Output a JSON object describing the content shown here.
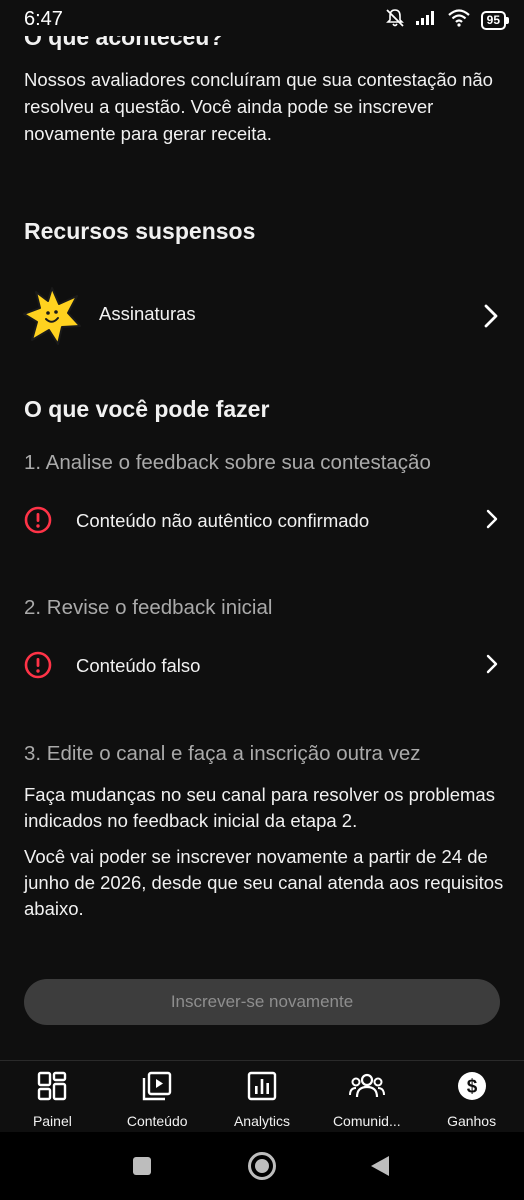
{
  "status_bar": {
    "time": "6:47",
    "battery": "95"
  },
  "intro": {
    "heading": "O que aconteceu?",
    "body": "Nossos avaliadores concluíram que sua contestação não resolveu a questão. Você ainda pode se inscrever novamente para gerar receita."
  },
  "suspended": {
    "heading": "Recursos suspensos",
    "items": [
      {
        "label": "Assinaturas",
        "icon": "memberships-star-icon"
      }
    ]
  },
  "actions": {
    "heading": "O que você pode fazer",
    "step1": {
      "title": "1. Analise o feedback sobre sua contestação",
      "item": "Conteúdo não autêntico confirmado"
    },
    "step2": {
      "title": "2. Revise o feedback inicial",
      "item": "Conteúdo falso"
    },
    "step3": {
      "title": "3. Edite o canal e faça a inscrição outra vez",
      "p1": "Faça mudanças no seu canal para resolver os problemas indicados no feedback inicial da etapa 2.",
      "p2": "Você vai poder se inscrever novamente a partir de 24 de junho de 2026, desde que seu canal atenda aos requisitos abaixo."
    },
    "reapply_button": "Inscrever-se novamente"
  },
  "bottom_nav": [
    {
      "label": "Painel",
      "icon": "dashboard-icon"
    },
    {
      "label": "Conteúdo",
      "icon": "content-icon"
    },
    {
      "label": "Analytics",
      "icon": "analytics-icon"
    },
    {
      "label": "Comunid...",
      "icon": "community-icon"
    },
    {
      "label": "Ganhos",
      "icon": "earn-icon"
    }
  ],
  "colors": {
    "background": "#0f0f0f",
    "alert": "#ff3347",
    "star": "#ffd21f",
    "muted": "#aaaaaa"
  }
}
